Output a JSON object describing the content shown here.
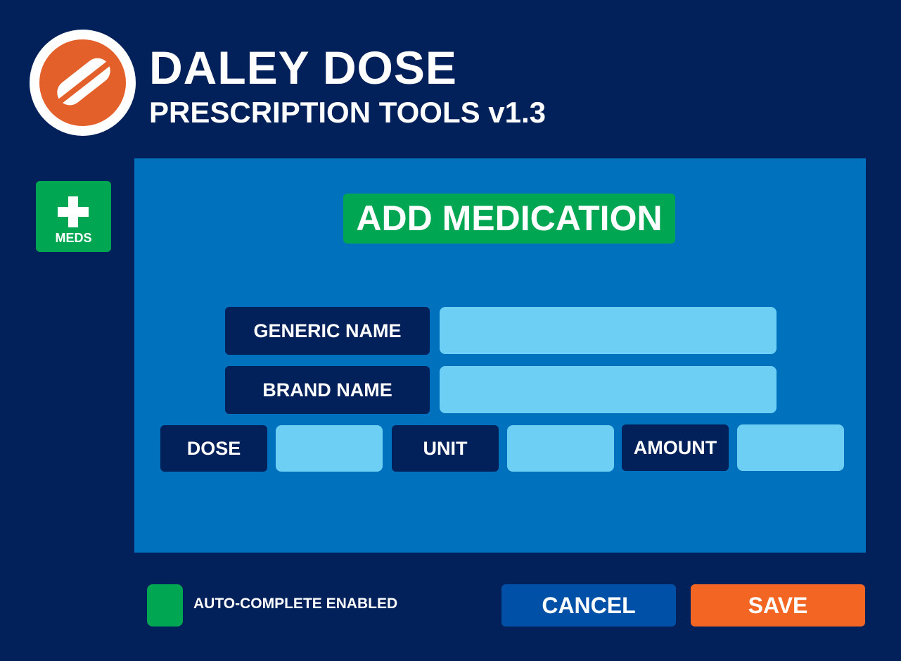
{
  "header": {
    "title": "DALEY DOSE",
    "subtitle": "PRESCRIPTION TOOLS v1.3"
  },
  "sidebar": {
    "meds_button_label": "MEDS"
  },
  "form": {
    "title": "ADD MEDICATION",
    "fields": {
      "generic_name": {
        "label": "GENERIC NAME",
        "value": ""
      },
      "brand_name": {
        "label": "BRAND NAME",
        "value": ""
      },
      "dose": {
        "label": "DOSE",
        "value": ""
      },
      "unit": {
        "label": "UNIT",
        "value": ""
      },
      "amount": {
        "label": "AMOUNT",
        "value": ""
      }
    }
  },
  "footer": {
    "autocomplete_label": "AUTO-COMPLETE ENABLED",
    "autocomplete_enabled": true,
    "cancel_label": "CANCEL",
    "save_label": "SAVE"
  },
  "colors": {
    "background": "#02205a",
    "panel": "#0071bd",
    "accent_green": "#00a651",
    "input": "#6ecff5",
    "save": "#f26522",
    "cancel": "#0050a8",
    "logo": "#e4602a"
  },
  "icons": {
    "logo": "pill-icon",
    "meds": "plus-icon"
  }
}
